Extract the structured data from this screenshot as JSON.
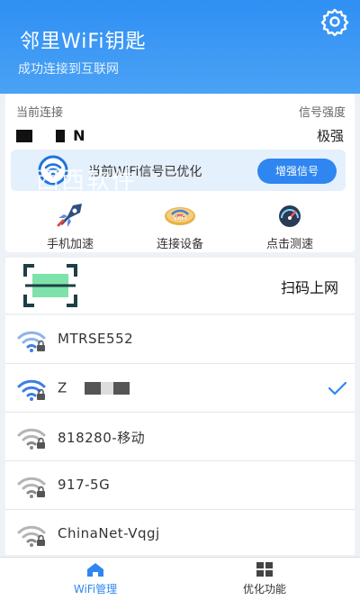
{
  "header": {
    "title": "邻里WiFi钥匙",
    "subtitle": "成功连接到互联网",
    "settings_icon": "gear-icon"
  },
  "current": {
    "label": "当前连接",
    "ssid_visible": "N",
    "signal_label": "信号强度",
    "signal_value": "极强"
  },
  "banner": {
    "text": "当前WiFi信号已优化",
    "button": "增强信号",
    "icon": "wifi-signal-icon"
  },
  "watermark": "西西软件",
  "quick_actions": [
    {
      "label": "手机加速",
      "icon": "rocket-icon"
    },
    {
      "label": "连接设备",
      "icon": "devices-icon"
    },
    {
      "label": "点击测速",
      "icon": "speedometer-icon"
    }
  ],
  "scan": {
    "label": "扫码上网",
    "icon": "qr-scan-icon"
  },
  "networks": [
    {
      "name": "MTRSE552",
      "locked": true,
      "connected": false
    },
    {
      "name": "Z",
      "locked": true,
      "connected": true
    },
    {
      "name": "818280-移动",
      "locked": true,
      "connected": false
    },
    {
      "name": "917-5G",
      "locked": true,
      "connected": false
    },
    {
      "name": "ChinaNet-Vqgj",
      "locked": true,
      "connected": false
    }
  ],
  "tabs": [
    {
      "label": "WiFi管理",
      "icon": "home-icon",
      "active": true
    },
    {
      "label": "优化功能",
      "icon": "grid-icon",
      "active": false
    }
  ],
  "colors": {
    "accent": "#2f86f0",
    "header": "#3d99f4",
    "background": "#eef1f5"
  }
}
